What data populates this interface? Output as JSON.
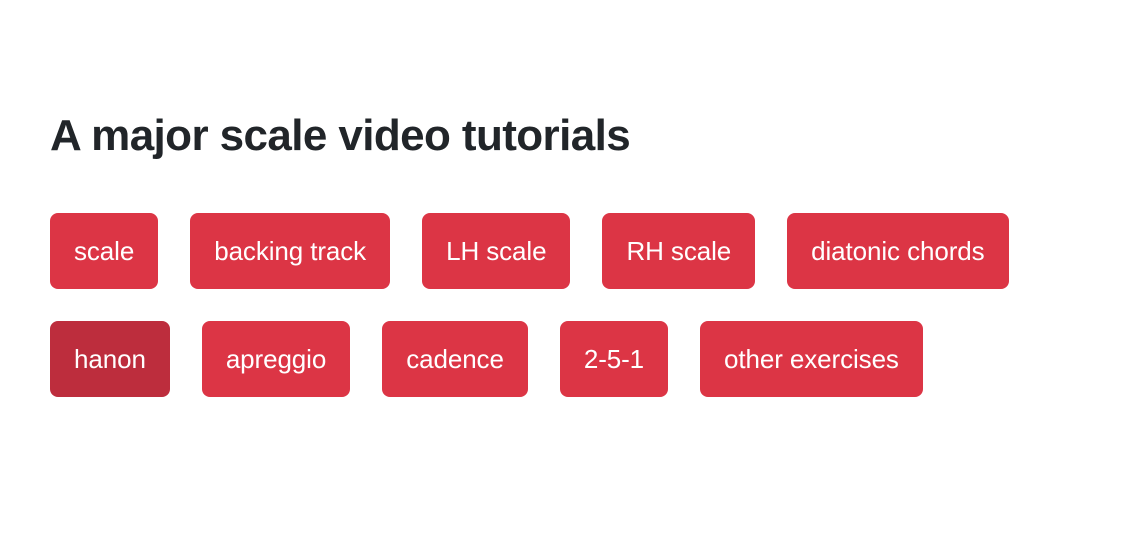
{
  "page": {
    "background_color": "#ffffff",
    "title": "A major scale video tutorials",
    "title_color": "#212529"
  },
  "theme": {
    "tag_color": "#dc3545",
    "tag_active_color": "#bd2d3d",
    "tag_text_color": "#ffffff"
  },
  "tags": {
    "rows": [
      {
        "items": [
          {
            "label": "scale",
            "active": false
          },
          {
            "label": "backing track",
            "active": false
          },
          {
            "label": "LH scale",
            "active": false
          },
          {
            "label": "RH scale",
            "active": false
          },
          {
            "label": "diatonic chords",
            "active": false
          }
        ]
      },
      {
        "items": [
          {
            "label": "hanon",
            "active": true
          },
          {
            "label": "apreggio",
            "active": false
          },
          {
            "label": "cadence",
            "active": false
          },
          {
            "label": "2-5-1",
            "active": false
          },
          {
            "label": "other exercises",
            "active": false
          }
        ]
      }
    ]
  }
}
